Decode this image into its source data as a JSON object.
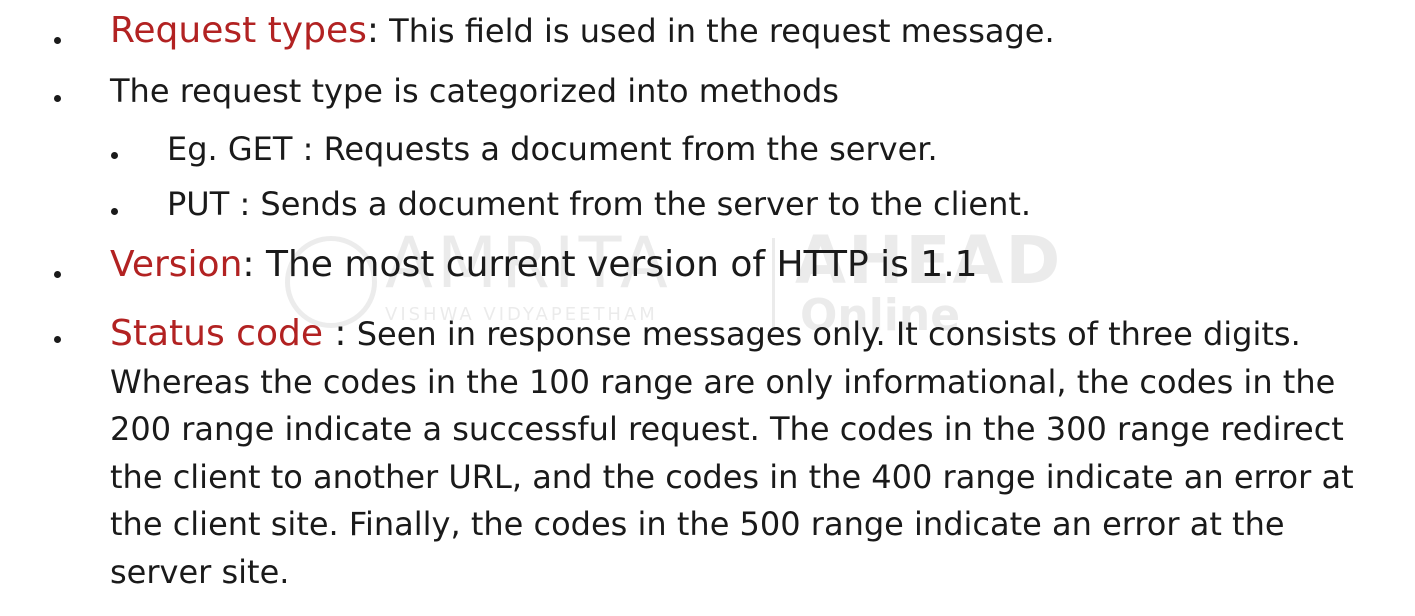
{
  "watermark": {
    "name": "AMRITA",
    "subtitle": "VISHWA VIDYAPEETHAM",
    "brand": "AHEAD",
    "brand_sub": "Online"
  },
  "items": {
    "request_types": {
      "term": "Request types",
      "separator": ":",
      "text": " This field is used in the request message."
    },
    "request_type_desc": {
      "text": "The request type is categorized into methods"
    },
    "get": {
      "text": "Eg. GET  : Requests a document from the server."
    },
    "put": {
      "text": "PUT   :  Sends a document from the server to the client."
    },
    "version": {
      "term": "Version",
      "separator": ":",
      "text": " The most current version of HTTP is 1.1"
    },
    "status_code": {
      "term": "Status code",
      "separator": " :",
      "text": " Seen in response messages only. It consists of three digits. Whereas the codes in the 100 range are only informational, the codes in the 200 range indicate a successful request. The codes in the 300 range redirect the client to another URL, and the codes in the 400 range indicate an error at the client site. Finally, the codes in the 500 range indicate an error at the server site."
    }
  }
}
